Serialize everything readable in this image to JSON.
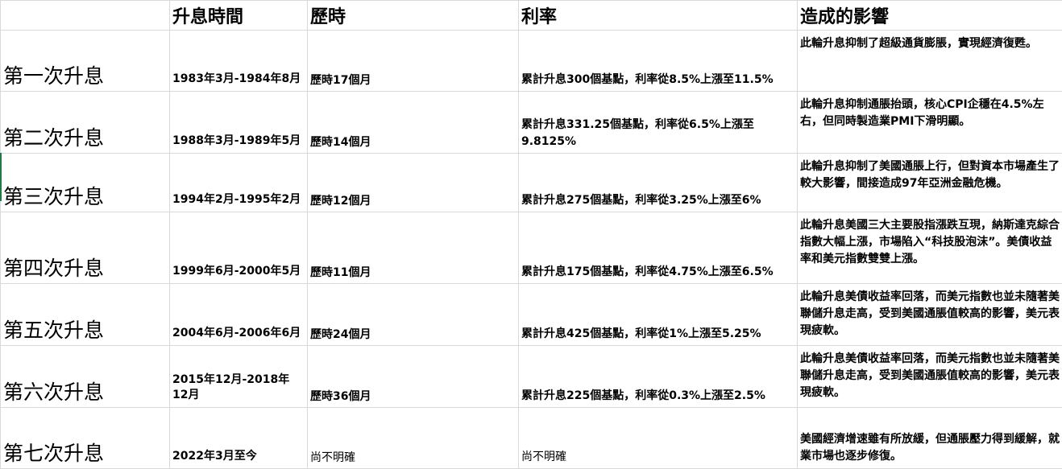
{
  "headers": [
    "",
    "升息時間",
    "歷時",
    "利率",
    "造成的影響"
  ],
  "rows": [
    {
      "label": "第一次升息",
      "period": "1983年3月-1984年8月",
      "duration": "歷時17個月",
      "rate": "累計升息300個基點，利率從8.5%上漲至11.5%",
      "effect": "此輪升息抑制了超級通貨膨脹，實現經濟復甦。"
    },
    {
      "label": "第二次升息",
      "period": "1988年3月-1989年5月",
      "duration": "歷時14個月",
      "rate": "累計升息331.25個基點，利率從6.5%上漲至9.8125%",
      "effect": "此輪升息抑制通脹抬頭，核心CPI企穩在4.5%左右，但同時製造業PMI下滑明顯。"
    },
    {
      "label": "第三次升息",
      "period": "1994年2月-1995年2月",
      "duration": "歷時12個月",
      "rate": "累計升息275個基點，利率從3.25%上漲至6%",
      "effect": "此輪升息抑制了美國通脹上行，但對資本市場產生了較大影響，間接造成97年亞洲金融危機。"
    },
    {
      "label": "第四次升息",
      "period": "1999年6月-2000年5月",
      "duration": "歷時11個月",
      "rate": "累計升息175個基點，利率從4.75%上漲至6.5%",
      "effect": "此輪升息美國三大主要股指漲跌互現，納斯達克綜合指數大幅上漲，市場陷入“科技股泡沫”。美債收益率和美元指數雙雙上漲。"
    },
    {
      "label": "第五次升息",
      "period": "2004年6月-2006年6月",
      "duration": "歷時24個月",
      "rate": "累計升息425個基點，利率從1%上漲至5.25%",
      "effect": "此輪升息美債收益率回落，而美元指數也並未隨著美聯儲升息走高，受到美國通脹值較高的影響，美元表現疲軟。"
    },
    {
      "label": "第六次升息",
      "period": "2015年12月-2018年12月",
      "duration": "歷時36個月",
      "rate": "累計升息225個基點，利率從0.3%上漲至2.5%",
      "effect": "此輪升息美債收益率回落，而美元指數也並未隨著美聯儲升息走高，受到美國通脹值較高的影響，美元表現疲軟。"
    },
    {
      "label": "第七次升息",
      "period": "2022年3月至今",
      "duration": "尚不明確",
      "rate": "尚不明確",
      "effect": "美國經濟增速雖有所放緩，但通脹壓力得到緩解，就業市場也逐步修復。"
    }
  ]
}
